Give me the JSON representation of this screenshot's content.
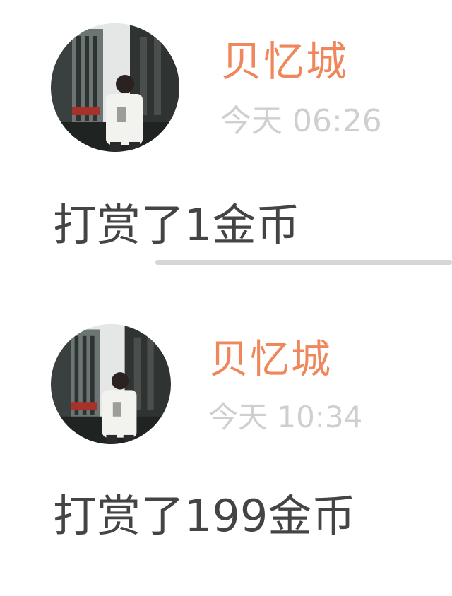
{
  "colors": {
    "username": "#f0875c",
    "timestamp": "#cfcfcf",
    "message_text": "#444444",
    "divider": "#d6d6d6",
    "background": "#ffffff"
  },
  "entries": [
    {
      "avatar_icon": "user-avatar-photo",
      "username": "贝忆城",
      "timestamp": "今天 06:26",
      "message": "打赏了1金币"
    },
    {
      "avatar_icon": "user-avatar-photo",
      "username": "贝忆城",
      "timestamp": "今天 10:34",
      "message": "打赏了199金币"
    }
  ]
}
